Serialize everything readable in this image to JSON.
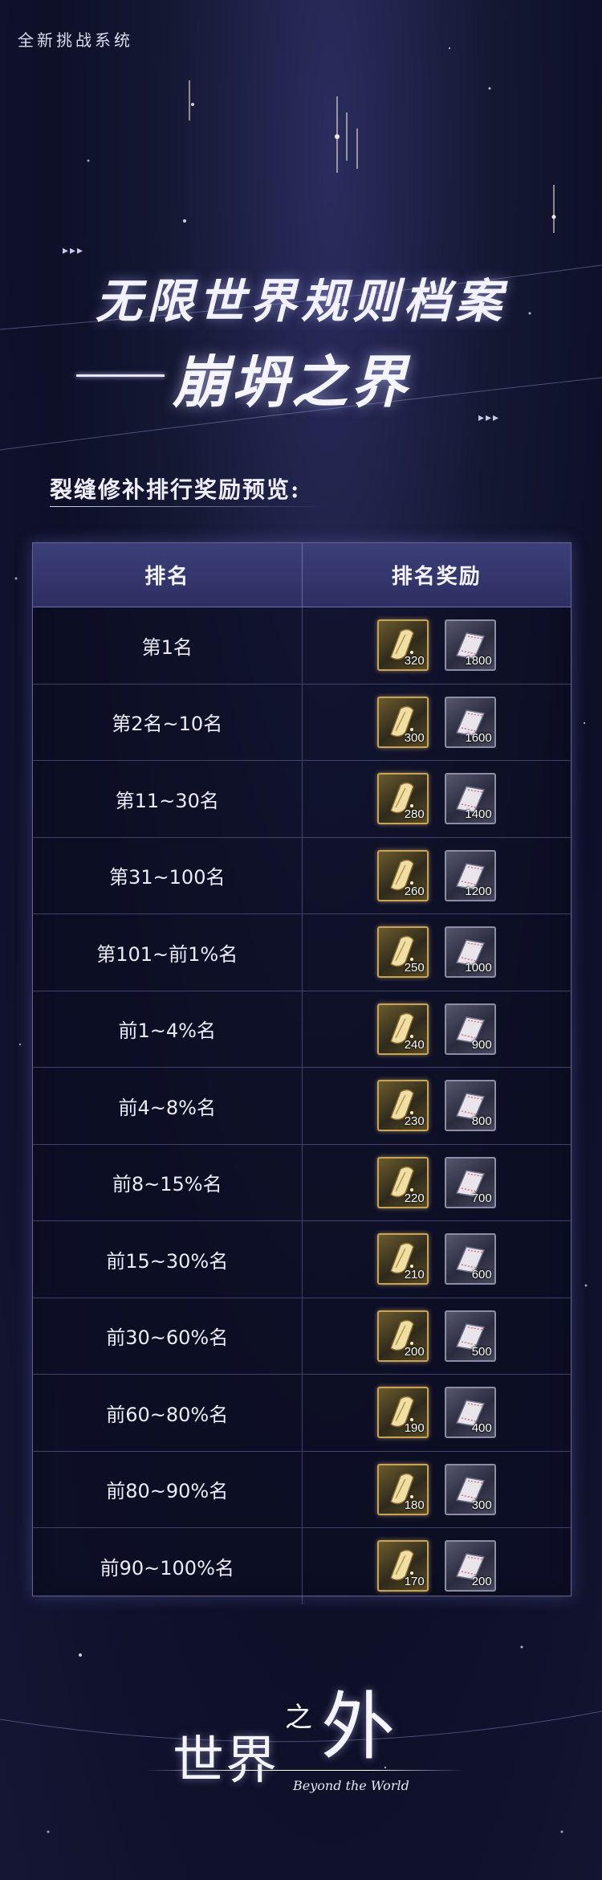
{
  "header": {
    "tag": "全新挑战系统",
    "title": "无限世界规则档案",
    "subtitle": "崩坍之界"
  },
  "section": {
    "label": "裂缝修补排行奖励预览:"
  },
  "table": {
    "columns": [
      "排名",
      "排名奖励"
    ],
    "rows": [
      {
        "rank": "第1名",
        "gold_qty": "320",
        "silver_qty": "1800"
      },
      {
        "rank": "第2名~10名",
        "gold_qty": "300",
        "silver_qty": "1600"
      },
      {
        "rank": "第11~30名",
        "gold_qty": "280",
        "silver_qty": "1400"
      },
      {
        "rank": "第31~100名",
        "gold_qty": "260",
        "silver_qty": "1200"
      },
      {
        "rank": "第101~前1%名",
        "gold_qty": "250",
        "silver_qty": "1000"
      },
      {
        "rank": "前1~4%名",
        "gold_qty": "240",
        "silver_qty": "900"
      },
      {
        "rank": "前4~8%名",
        "gold_qty": "230",
        "silver_qty": "800"
      },
      {
        "rank": "前8~15%名",
        "gold_qty": "220",
        "silver_qty": "700"
      },
      {
        "rank": "前15~30%名",
        "gold_qty": "210",
        "silver_qty": "600"
      },
      {
        "rank": "前30~60%名",
        "gold_qty": "200",
        "silver_qty": "500"
      },
      {
        "rank": "前60~80%名",
        "gold_qty": "190",
        "silver_qty": "400"
      },
      {
        "rank": "前80~90%名",
        "gold_qty": "180",
        "silver_qty": "300"
      },
      {
        "rank": "前90~100%名",
        "gold_qty": "170",
        "silver_qty": "200"
      }
    ]
  },
  "logo": {
    "main": "世界",
    "zhi": "之",
    "wai": "外",
    "script": "Beyond the World"
  },
  "icons": {
    "reward_a": "gold-feather-scroll-icon",
    "reward_b": "silver-film-scroll-icon"
  },
  "colors": {
    "background": "#151833",
    "header_row": "#3c3f78",
    "gold_frame": "#c9a458",
    "silver_frame": "#8c8ea8"
  }
}
